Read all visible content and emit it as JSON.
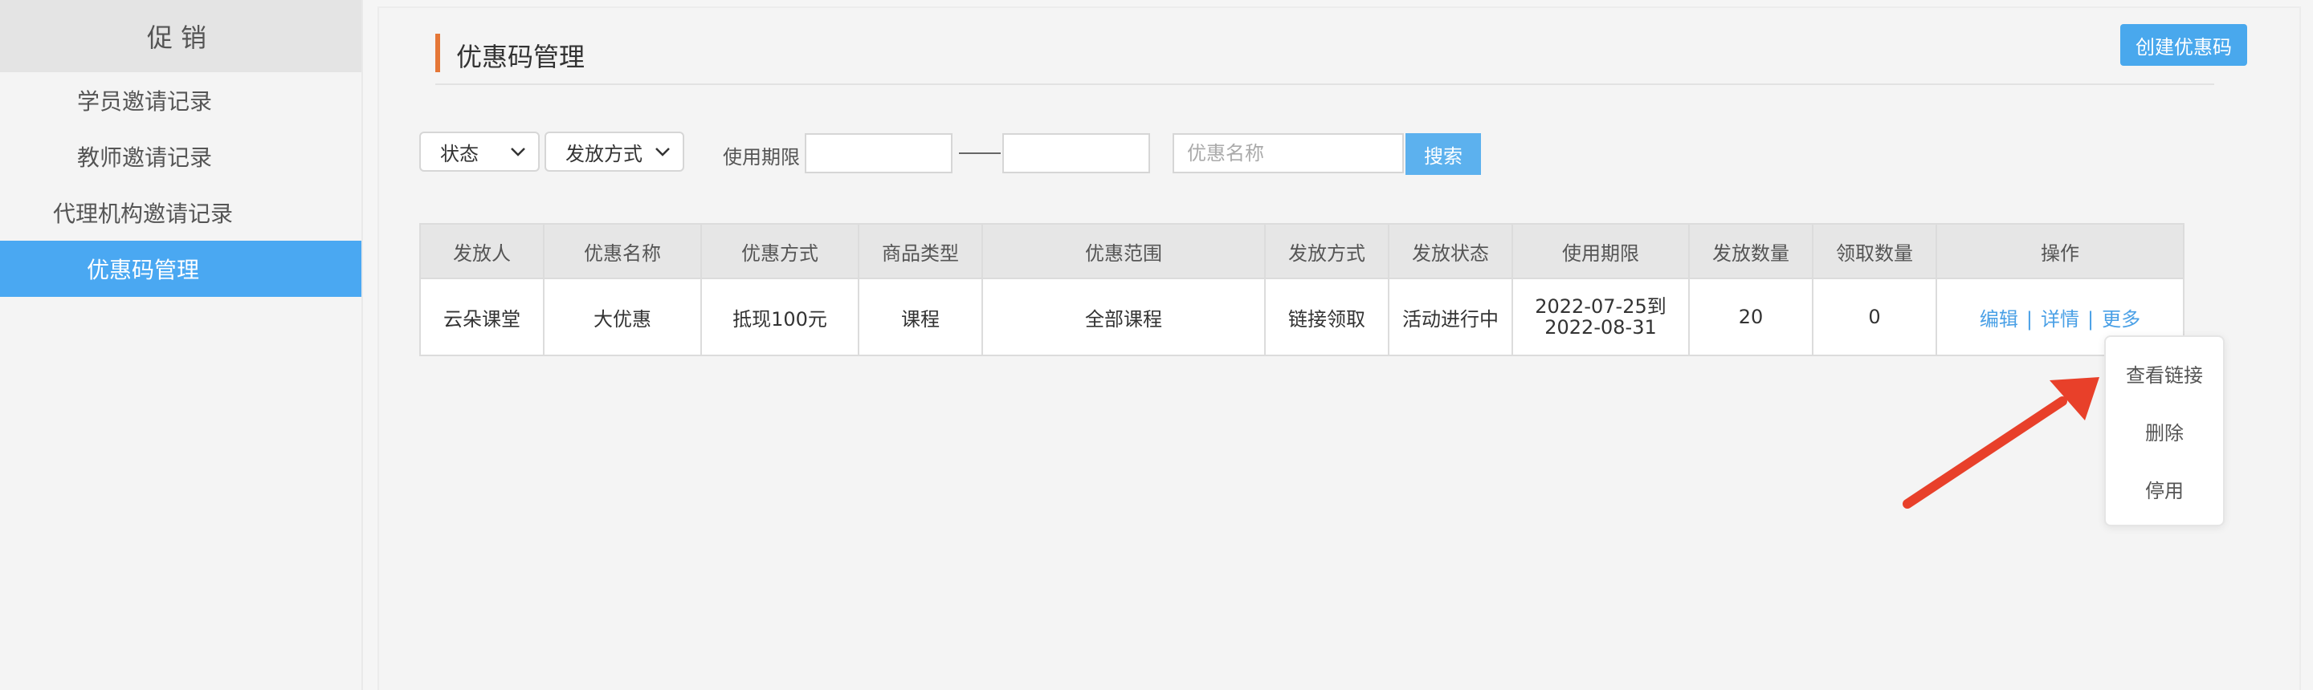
{
  "sidebar": {
    "header": "促销",
    "items": [
      {
        "label": "学员邀请记录",
        "active": false
      },
      {
        "label": "教师邀请记录",
        "active": false
      },
      {
        "label": "代理机构邀请记录",
        "active": false
      },
      {
        "label": "优惠码管理",
        "active": true
      }
    ]
  },
  "header": {
    "title": "优惠码管理",
    "create_button": "创建优惠码"
  },
  "filters": {
    "status_select": "状态",
    "method_select": "发放方式",
    "period_label": "使用期限",
    "start_date": "",
    "end_date": "",
    "name_placeholder": "优惠名称",
    "search_button": "搜索"
  },
  "table": {
    "columns": [
      "发放人",
      "优惠名称",
      "优惠方式",
      "商品类型",
      "优惠范围",
      "发放方式",
      "发放状态",
      "使用期限",
      "发放数量",
      "领取数量",
      "操作"
    ],
    "rows": [
      {
        "issuer": "云朵课堂",
        "name": "大优惠",
        "method": "抵现100元",
        "product_type": "课程",
        "scope": "全部课程",
        "issue_method": "链接领取",
        "status": "活动进行中",
        "period": "2022-07-25到 2022-08-31",
        "issued_count": "20",
        "received_count": "0",
        "actions": [
          "编辑",
          "详情",
          "更多"
        ]
      }
    ]
  },
  "more_menu": {
    "items": [
      "查看链接",
      "删除",
      "停用"
    ]
  },
  "colors": {
    "accent_blue": "#4aa8f2",
    "title_accent": "#e57737",
    "arrow_red": "#e8402a"
  }
}
